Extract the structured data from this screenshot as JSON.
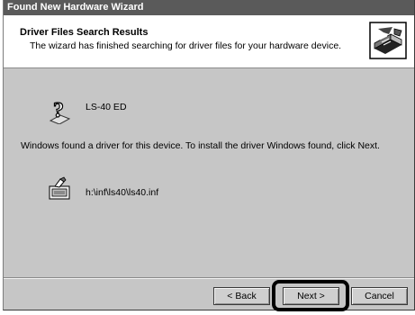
{
  "window": {
    "title": "Found New Hardware Wizard"
  },
  "header": {
    "title": "Driver Files Search Results",
    "subtitle": "The wizard has finished searching for driver files for your hardware device."
  },
  "icons": {
    "wizard": "hardware-wizard-icon",
    "device": "unknown-device-icon",
    "file": "driver-file-icon"
  },
  "device": {
    "name": "LS-40 ED"
  },
  "message": "Windows found a driver for this device. To install the driver Windows found, click Next.",
  "driver_file": {
    "path": "h:\\inf\\ls40\\ls40.inf"
  },
  "buttons": {
    "back": "< Back",
    "next": "Next >",
    "cancel": "Cancel"
  }
}
